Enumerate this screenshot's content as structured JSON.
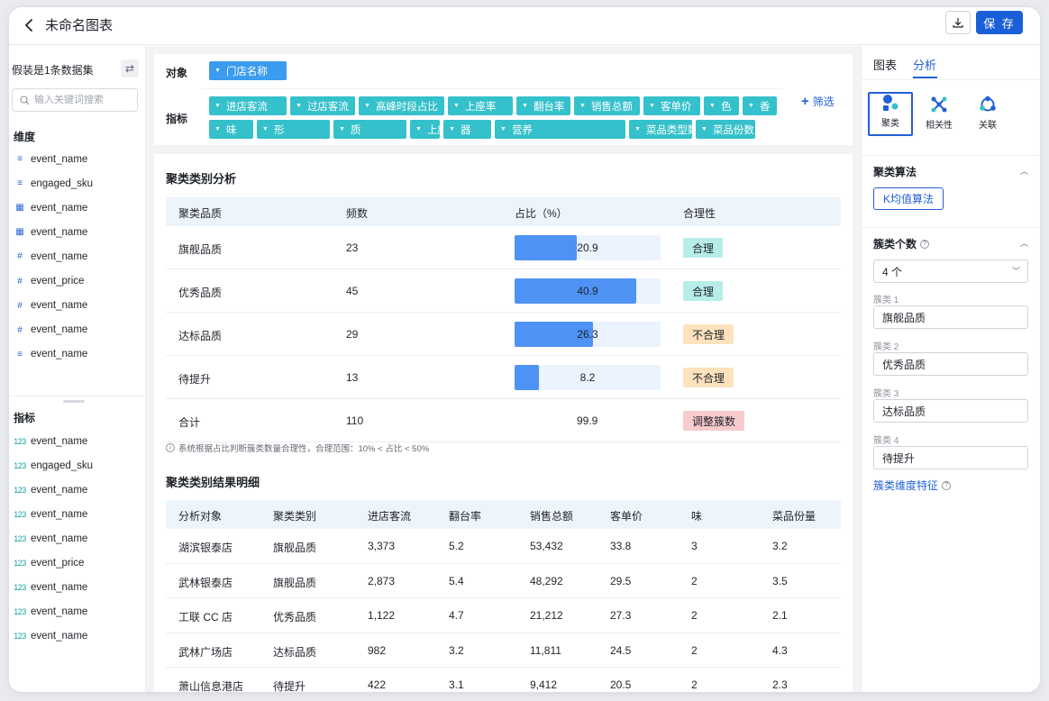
{
  "header": {
    "title": "未命名图表",
    "save_label": "保 存"
  },
  "sidebar": {
    "dataset_label": "假装是1条数据集",
    "search_placeholder": "输入关键词搜索",
    "dimensions_title": "维度",
    "dimensions": [
      {
        "type": "text",
        "name": "event_name"
      },
      {
        "type": "text",
        "name": "engaged_sku"
      },
      {
        "type": "date",
        "name": "event_name"
      },
      {
        "type": "date",
        "name": "event_name"
      },
      {
        "type": "number",
        "name": "event_name"
      },
      {
        "type": "number",
        "name": "event_price"
      },
      {
        "type": "number",
        "name": "event_name"
      },
      {
        "type": "number",
        "name": "event_name"
      },
      {
        "type": "text",
        "name": "event_name"
      }
    ],
    "measures_title": "指标",
    "measures": [
      "event_name",
      "engaged_sku",
      "event_name",
      "event_name",
      "event_name",
      "event_price",
      "event_name",
      "event_name",
      "event_name"
    ]
  },
  "config": {
    "object_label": "对象",
    "object_tag": "门店名称",
    "metrics_label": "指标",
    "metrics_row1": [
      "进店客流",
      "过店客流",
      "高峰时段占比",
      "上座率",
      "翻台率",
      "销售总额",
      "客单价",
      "色",
      "香"
    ],
    "metrics_row2": [
      "味",
      "形",
      "质",
      "上座率",
      "器",
      "营养",
      "菜品类型数量",
      "菜品份数"
    ],
    "filter_label": "筛选"
  },
  "cluster_analysis": {
    "title": "聚类类别分析",
    "columns": [
      "聚类品质",
      "频数",
      "占比（%）",
      "合理性"
    ],
    "rows": [
      {
        "quality": "旗舰品质",
        "freq": "23",
        "ratio": 20.9,
        "ratio_text": "20.9",
        "status": "合理",
        "status_kind": "ok"
      },
      {
        "quality": "优秀品质",
        "freq": "45",
        "ratio": 40.9,
        "ratio_text": "40.9",
        "status": "合理",
        "status_kind": "ok"
      },
      {
        "quality": "达标品质",
        "freq": "29",
        "ratio": 26.3,
        "ratio_text": "26.3",
        "status": "不合理",
        "status_kind": "warn"
      },
      {
        "quality": "待提升",
        "freq": "13",
        "ratio": 8.2,
        "ratio_text": "8.2",
        "status": "不合理",
        "status_kind": "warn"
      }
    ],
    "total": {
      "label": "合计",
      "freq": "110",
      "ratio_text": "99.9",
      "action": "调整簇数"
    },
    "hint": "系统根据占比判断簇类数量合理性，合理范围：10% < 占比 < 50%"
  },
  "cluster_detail": {
    "title": "聚类类别结果明细",
    "columns": [
      "分析对象",
      "聚类类别",
      "进店客流",
      "翻台率",
      "销售总额",
      "客单价",
      "味",
      "菜品份量"
    ],
    "rows": [
      [
        "湖滨银泰店",
        "旗舰品质",
        "3,373",
        "5.2",
        "53,432",
        "33.8",
        "3",
        "3.2"
      ],
      [
        "武林银泰店",
        "旗舰品质",
        "2,873",
        "5.4",
        "48,292",
        "29.5",
        "2",
        "3.5"
      ],
      [
        "工联 CC 店",
        "优秀品质",
        "1,122",
        "4.7",
        "21,212",
        "27.3",
        "2",
        "2.1"
      ],
      [
        "武林广场店",
        "达标品质",
        "982",
        "3.2",
        "11,811",
        "24.5",
        "2",
        "4.3"
      ],
      [
        "萧山信息港店",
        "待提升",
        "422",
        "3.1",
        "9,412",
        "20.5",
        "2",
        "2.3"
      ]
    ]
  },
  "right_panel": {
    "tabs": [
      "图表",
      "分析"
    ],
    "active_tab": "分析",
    "algorithms": [
      "聚类",
      "相关性",
      "关联"
    ],
    "algo_section_title": "聚类算法",
    "algo_button": "K均值算法",
    "count_section_title": "簇类个数",
    "count_value": "4 个",
    "clusters": [
      {
        "label": "簇类 1",
        "value": "旗舰品质"
      },
      {
        "label": "簇类 2",
        "value": "优秀品质"
      },
      {
        "label": "簇类 3",
        "value": "达标品质"
      },
      {
        "label": "簇类 4",
        "value": "待提升"
      }
    ],
    "feature_link": "簇类维度特征"
  },
  "colors": {
    "accent": "#2260d6",
    "tag": "#35c1cb",
    "bar": "#4e92f4"
  }
}
